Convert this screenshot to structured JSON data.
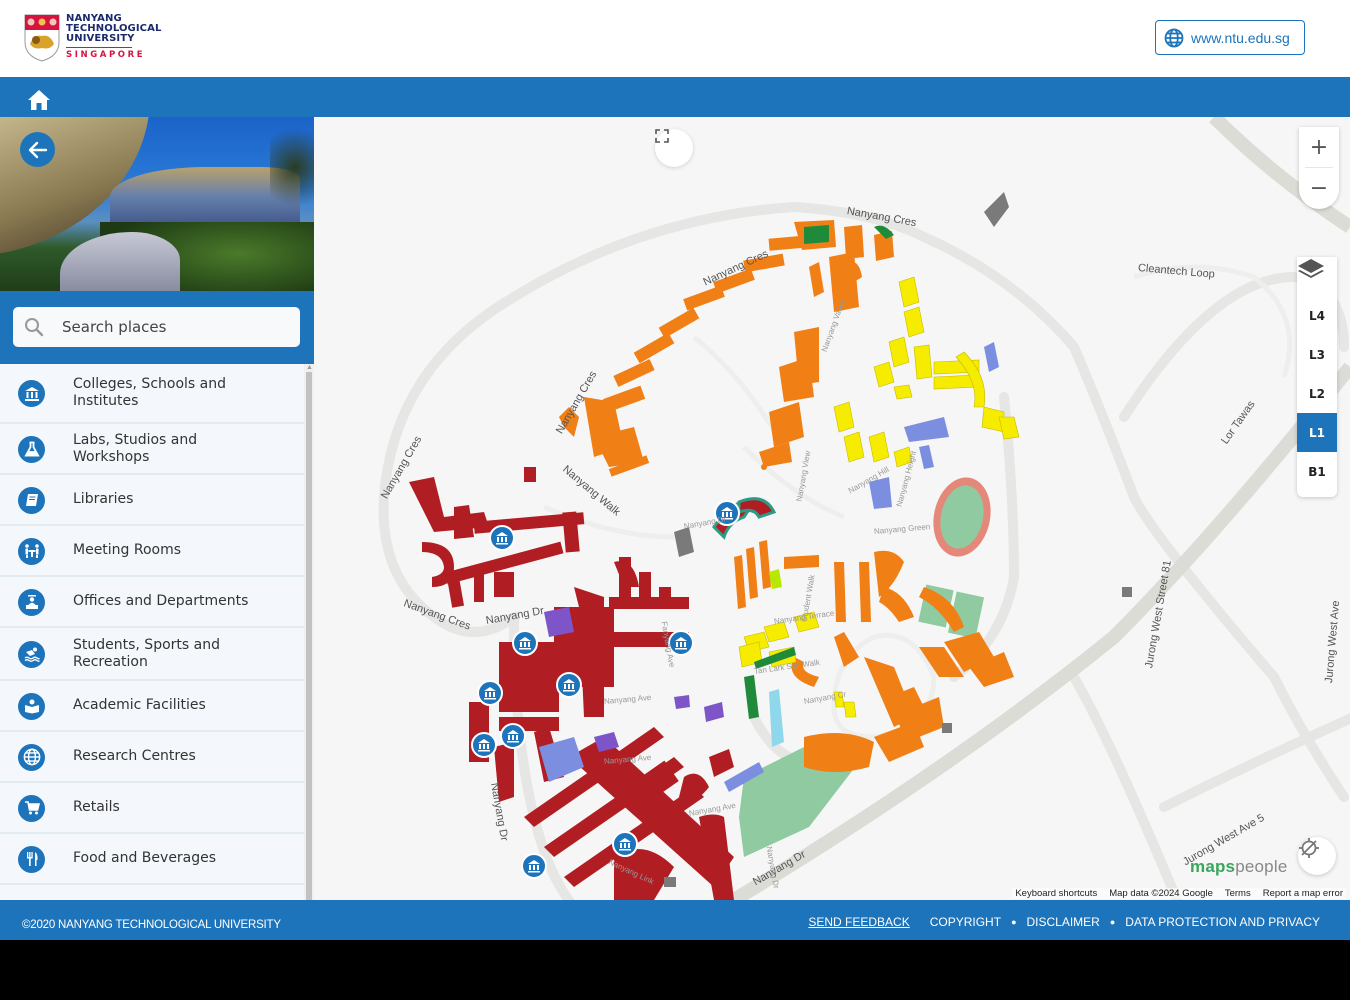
{
  "header": {
    "logo": {
      "lines": [
        "NANYANG",
        "TECHNOLOGICAL",
        "UNIVERSITY"
      ],
      "subline": "SINGAPORE"
    },
    "website_link": {
      "label": "www.ntu.edu.sg",
      "icon": "globe-icon"
    }
  },
  "navbar": {
    "home_icon": "home-icon"
  },
  "sidebar": {
    "back_icon": "arrow-left-icon",
    "search": {
      "placeholder": "Search places",
      "value": "",
      "icon": "search-icon"
    },
    "categories": [
      {
        "label": "Colleges, Schools and Institutes",
        "icon": "institution-icon"
      },
      {
        "label": "Labs, Studios and Workshops",
        "icon": "flask-icon"
      },
      {
        "label": "Libraries",
        "icon": "book-icon"
      },
      {
        "label": "Meeting Rooms",
        "icon": "meeting-icon"
      },
      {
        "label": "Offices and Departments",
        "icon": "office-desk-icon"
      },
      {
        "label": "Students, Sports and Recreation",
        "icon": "swimmer-icon"
      },
      {
        "label": "Academic Facilities",
        "icon": "reading-icon"
      },
      {
        "label": "Research Centres",
        "icon": "globe-icon"
      },
      {
        "label": "Retails",
        "icon": "cart-icon"
      },
      {
        "label": "Food and Beverages",
        "icon": "cutlery-icon"
      }
    ]
  },
  "map": {
    "zoom_in": "+",
    "zoom_out": "−",
    "floors": [
      "L4",
      "L3",
      "L2",
      "L1",
      "B1"
    ],
    "active_floor": "L1",
    "street_labels": [
      "Nanyang Cres",
      "Nanyang Cres",
      "Nanyang Cres",
      "Nanyang Cres",
      "Cleantech Loop",
      "Lor Tawas",
      "Nanyang Walk",
      "Nanyang Dr",
      "Nanyang Dr",
      "Nanyang Ave",
      "Nanyang Ave",
      "Nanyang Green",
      "Jurong West Street 81",
      "Jurong West Ave 5",
      "Jurong West Ave",
      "Nanyang Dr",
      "Nanyang Ave",
      "Nanyang Link",
      "Nanyang Terrace",
      "Tan Lark Sye Walk",
      "Nanyang Cr",
      "Nanyang Hill",
      "Student Walk",
      "Nanyang View",
      "Nanyang Valley",
      "Nanyang Height",
      "Fanyang Ave",
      "Nanyang Dr"
    ],
    "brand": {
      "a": "maps",
      "b": "people"
    },
    "attribution": [
      "Keyboard shortcuts",
      "Map data ©2024 Google",
      "Terms",
      "Report a map error"
    ]
  },
  "footer": {
    "copyright": "©2020 NANYANG TECHNOLOGICAL UNIVERSITY",
    "links": [
      "SEND FEEDBACK",
      "COPYRIGHT",
      "DISCLAIMER",
      "DATA PROTECTION AND PRIVACY"
    ]
  },
  "colors": {
    "brand_blue": "#1d74bb",
    "ntu_navy": "#1b2a6b",
    "ntu_red": "#d71440",
    "academic_red": "#b01e23",
    "hall_orange": "#f07f16",
    "hall_yellow": "#f5ec00",
    "admin_purple": "#7e55c8",
    "sports_green": "#8fcaa0",
    "facility_blue": "#7b8ee0"
  }
}
